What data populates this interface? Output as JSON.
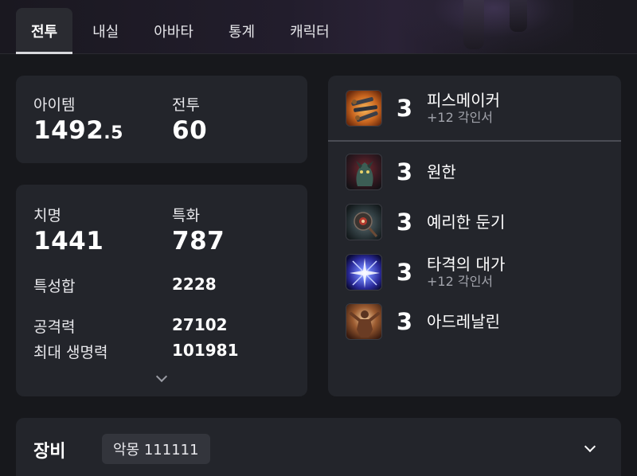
{
  "tabs": [
    "전투",
    "내실",
    "아바타",
    "통계",
    "캐릭터"
  ],
  "summary": {
    "item_label": "아이템",
    "item_value_int": "1492",
    "item_value_frac": ".5",
    "combat_label": "전투",
    "combat_value": "60"
  },
  "stats": {
    "crit_label": "치명",
    "crit_value": "1441",
    "spec_label": "특화",
    "spec_value": "787",
    "total_label": "특성합",
    "total_value": "2228",
    "attack_label": "공격력",
    "attack_value": "27102",
    "hp_label": "최대 생명력",
    "hp_value": "101981",
    "expand_icon": "chevron-down-icon"
  },
  "engravings": [
    {
      "level": "3",
      "name": "피스메이커",
      "sub": "+12 각인서",
      "icon": "peacemaker-icon"
    },
    {
      "level": "3",
      "name": "원한",
      "sub": "",
      "icon": "grudge-icon"
    },
    {
      "level": "3",
      "name": "예리한 둔기",
      "sub": "",
      "icon": "keen-blunt-weapon-icon"
    },
    {
      "level": "3",
      "name": "타격의 대가",
      "sub": "+12 각인서",
      "icon": "hit-master-icon"
    },
    {
      "level": "3",
      "name": "아드레날린",
      "sub": "",
      "icon": "adrenaline-icon"
    }
  ],
  "equipment": {
    "title": "장비",
    "badge": "악몽 111111",
    "expand_icon": "chevron-down-icon"
  },
  "colors": {
    "background": "#17181c",
    "card": "#23252b",
    "active_tab": "#2a2b31",
    "badge": "#33353c",
    "subtext": "#a2a4ac"
  }
}
